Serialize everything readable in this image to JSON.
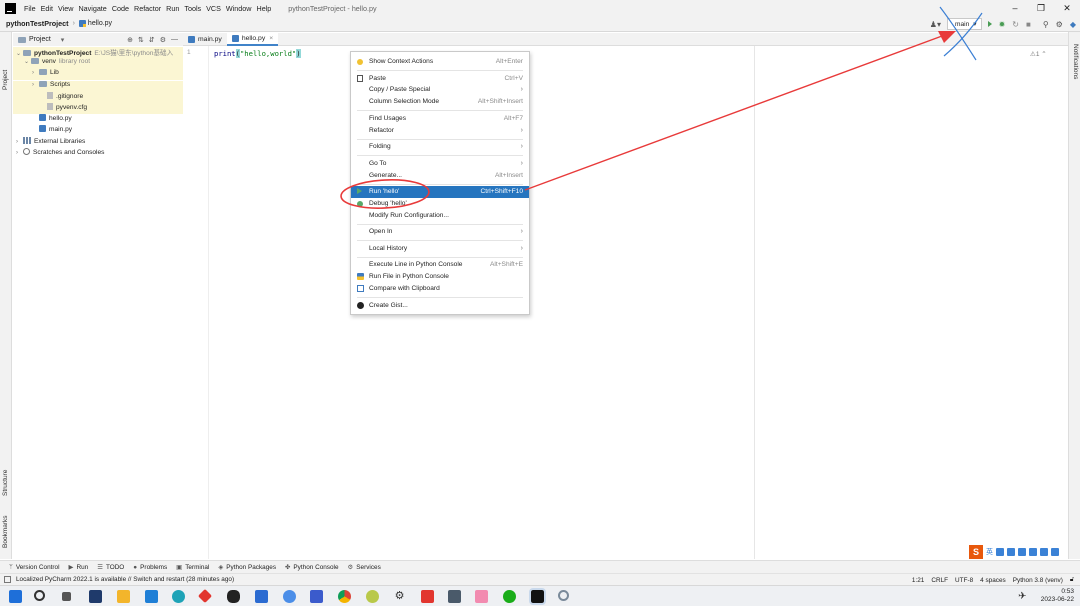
{
  "menubar": {
    "items": [
      "File",
      "Edit",
      "View",
      "Navigate",
      "Code",
      "Refactor",
      "Run",
      "Tools",
      "VCS",
      "Window",
      "Help"
    ],
    "window_title": "pythonTestProject - hello.py",
    "win_min": "–",
    "win_max": "❐",
    "win_close": "✕"
  },
  "navbar": {
    "project": "pythonTestProject",
    "file": "hello.py",
    "run_config": "main",
    "user_label": "♟▾"
  },
  "project_panel": {
    "title": "Project",
    "dropdown": "▾",
    "tools": [
      "⊕",
      "⇅",
      "⇵",
      "⚙",
      "—"
    ],
    "tree": [
      {
        "label": "pythonTestProject",
        "dim": "E:\\JS猫\\里东\\python基础入",
        "indent": 0,
        "chev": "⌄",
        "type": "folder-open",
        "bold": true,
        "hl": true
      },
      {
        "label": "venv",
        "dim": "library root",
        "indent": 1,
        "chev": "⌄",
        "type": "folder-open",
        "hl": true
      },
      {
        "label": "Lib",
        "dim": "",
        "indent": 2,
        "chev": "›",
        "type": "folder",
        "hl": true
      },
      {
        "label": "Scripts",
        "dim": "",
        "indent": 2,
        "chev": "›",
        "type": "folder",
        "hl": true
      },
      {
        "label": ".gitignore",
        "dim": "",
        "indent": 3,
        "chev": "",
        "type": "file",
        "hl": true
      },
      {
        "label": "pyvenv.cfg",
        "dim": "",
        "indent": 3,
        "chev": "",
        "type": "file",
        "hl": true
      },
      {
        "label": "hello.py",
        "dim": "",
        "indent": 2,
        "chev": "",
        "type": "py",
        "hl": false
      },
      {
        "label": "main.py",
        "dim": "",
        "indent": 2,
        "chev": "",
        "type": "py",
        "hl": false
      },
      {
        "label": "External Libraries",
        "dim": "",
        "indent": 0,
        "chev": "›",
        "type": "lib",
        "hl": false
      },
      {
        "label": "Scratches and Consoles",
        "dim": "",
        "indent": 0,
        "chev": "›",
        "type": "scratch",
        "hl": false
      }
    ]
  },
  "left_stripe": {
    "project": "Project",
    "structure": "Structure",
    "bookmarks": "Bookmarks"
  },
  "right_stripe": {
    "notifications": "Notifications"
  },
  "editor": {
    "tabs": [
      {
        "label": "main.py",
        "active": false
      },
      {
        "label": "hello.py",
        "active": true
      }
    ],
    "tab_close": "×",
    "line_number": "1",
    "code_fn": "print",
    "code_open": "(",
    "code_str": "\"hello,world\"",
    "code_close": ")",
    "warning": "⚠1 ⌃"
  },
  "context_menu": {
    "items": [
      {
        "label": "Show Context Actions",
        "shortcut": "Alt+Enter",
        "icon": "bulb-icon",
        "arrow": false
      },
      {
        "sep": true
      },
      {
        "label": "Paste",
        "shortcut": "Ctrl+V",
        "icon": "paste-icon",
        "arrow": false
      },
      {
        "label": "Copy / Paste Special",
        "shortcut": "",
        "icon": "",
        "arrow": true
      },
      {
        "label": "Column Selection Mode",
        "shortcut": "Alt+Shift+Insert",
        "icon": "",
        "arrow": false
      },
      {
        "sep": true
      },
      {
        "label": "Find Usages",
        "shortcut": "Alt+F7",
        "icon": "",
        "arrow": false
      },
      {
        "label": "Refactor",
        "shortcut": "",
        "icon": "",
        "arrow": true
      },
      {
        "sep": true
      },
      {
        "label": "Folding",
        "shortcut": "",
        "icon": "",
        "arrow": true
      },
      {
        "sep": true
      },
      {
        "label": "Go To",
        "shortcut": "",
        "icon": "",
        "arrow": true
      },
      {
        "label": "Generate...",
        "shortcut": "Alt+Insert",
        "icon": "",
        "arrow": false
      },
      {
        "sep": true
      },
      {
        "label": "Run 'hello'",
        "shortcut": "Ctrl+Shift+F10",
        "icon": "run-icon",
        "arrow": false,
        "selected": true
      },
      {
        "label": "Debug 'hello'",
        "shortcut": "",
        "icon": "debug-icon",
        "arrow": false
      },
      {
        "label": "Modify Run Configuration...",
        "shortcut": "",
        "icon": "",
        "arrow": false
      },
      {
        "sep": true
      },
      {
        "label": "Open In",
        "shortcut": "",
        "icon": "",
        "arrow": true
      },
      {
        "sep": true
      },
      {
        "label": "Local History",
        "shortcut": "",
        "icon": "",
        "arrow": true
      },
      {
        "sep": true
      },
      {
        "label": "Execute Line in Python Console",
        "shortcut": "Alt+Shift+E",
        "icon": "",
        "arrow": false
      },
      {
        "label": "Run File in Python Console",
        "shortcut": "",
        "icon": "python-icon",
        "arrow": false
      },
      {
        "label": "Compare with Clipboard",
        "shortcut": "",
        "icon": "compare-icon",
        "arrow": false
      },
      {
        "sep": true
      },
      {
        "label": "Create Gist...",
        "shortcut": "",
        "icon": "github-icon",
        "arrow": false
      }
    ]
  },
  "bottom_toolbar": [
    {
      "label": "Version Control",
      "icon": "ᛘ"
    },
    {
      "label": "Run",
      "icon": "▶"
    },
    {
      "label": "TODO",
      "icon": "☰"
    },
    {
      "label": "Problems",
      "icon": "●"
    },
    {
      "label": "Terminal",
      "icon": "▣"
    },
    {
      "label": "Python Packages",
      "icon": "◈"
    },
    {
      "label": "Python Console",
      "icon": "✤"
    },
    {
      "label": "Services",
      "icon": "⚙"
    }
  ],
  "status": {
    "message": "Localized PyCharm 2022.1 is available // Switch and restart (28 minutes ago)",
    "position": "1:21",
    "line_sep": "CRLF",
    "encoding": "UTF-8",
    "indent": "4 spaces",
    "interpreter": "Python 3.8 (venv)"
  },
  "ime": {
    "logo": "S",
    "lang": "英"
  },
  "taskbar": {
    "time": "0:53",
    "date": "2023-06-22"
  },
  "colors": {
    "accent": "#2675bf",
    "annotation": "#e83a3a",
    "cross": "#3b7fd4"
  }
}
